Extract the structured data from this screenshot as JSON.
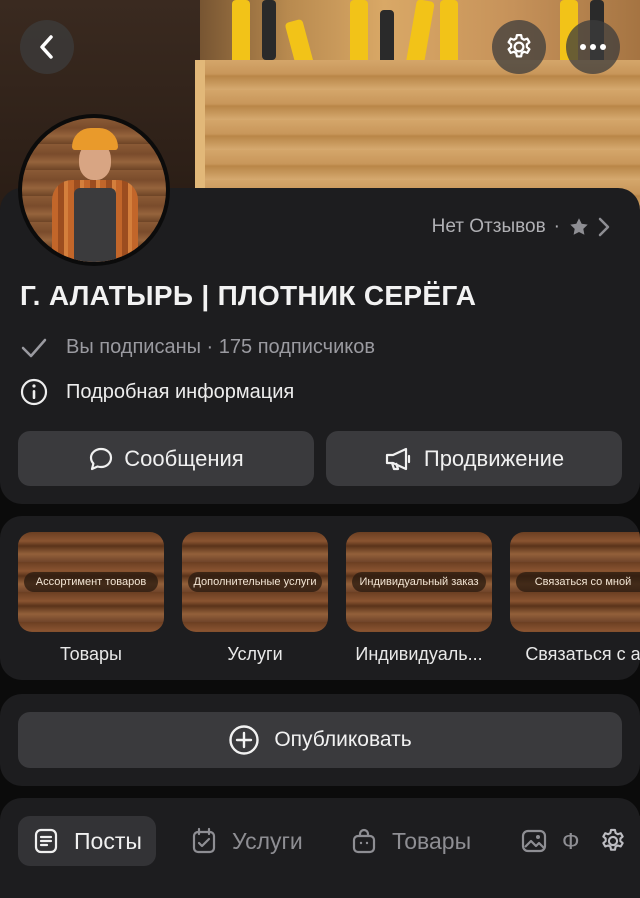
{
  "header_buttons": {
    "back_icon": "chevron-left-icon",
    "settings_icon": "gear-icon",
    "more_icon": "ellipsis-icon"
  },
  "reviews": {
    "text": "Нет Отзывов",
    "separator": "·"
  },
  "community": {
    "title": "Г. АЛАТЫРЬ | ПЛОТНИК СЕРЁГА",
    "subscription": "Вы подписаны · 175 подписчиков",
    "details": "Подробная информация"
  },
  "actions": {
    "messages": "Сообщения",
    "promotion": "Продвижение"
  },
  "showcase": [
    {
      "thumb_text": "Ассортимент товаров",
      "label": "Товары"
    },
    {
      "thumb_text": "Дополнительные услуги",
      "label": "Услуги"
    },
    {
      "thumb_text": "Индивидуальный заказ",
      "label": "Индивидуаль..."
    },
    {
      "thumb_text": "Связаться со мной",
      "label": "Связаться с а"
    }
  ],
  "publish": {
    "label": "Опубликовать"
  },
  "tabs": [
    {
      "label": "Посты",
      "icon": "document-icon",
      "active": true
    },
    {
      "label": "Услуги",
      "icon": "calendar-check-icon",
      "active": false
    },
    {
      "label": "Товары",
      "icon": "bag-icon",
      "active": false
    },
    {
      "label": "Ф",
      "icon": "image-icon",
      "active": false
    }
  ],
  "colors": {
    "background": "#0b0b0b",
    "card": "#1d1d1f",
    "button": "#3a3a3d",
    "muted_text": "#9a9aa0"
  }
}
